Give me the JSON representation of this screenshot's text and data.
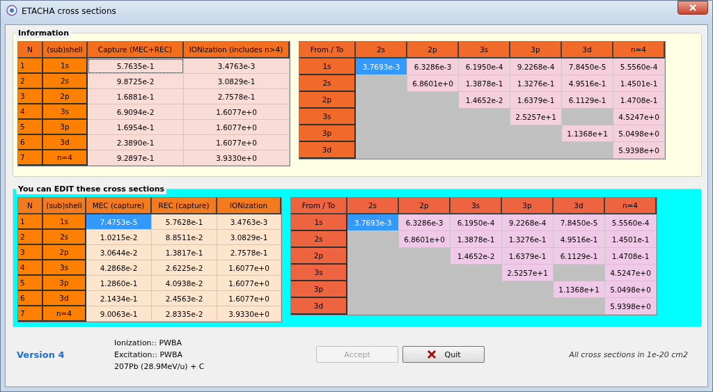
{
  "window": {
    "title": "ETACHA cross sections"
  },
  "information": {
    "title": "Information",
    "table": {
      "row_header_columns": [
        "N",
        "(sub)shell"
      ],
      "columns": [
        "Capture (MEC+REC)",
        "IONization (includes n>4)"
      ],
      "rows": [
        {
          "n": "1",
          "shell": "1s",
          "cells": [
            {
              "text": "5.7635e-1",
              "focused": true
            },
            {
              "text": "3.4763e-3",
              "focused": false
            }
          ]
        },
        {
          "n": "2",
          "shell": "2s",
          "cells": [
            {
              "text": "9.8725e-2",
              "focused": false
            },
            {
              "text": "3.0829e-1",
              "focused": false
            }
          ]
        },
        {
          "n": "3",
          "shell": "2p",
          "cells": [
            {
              "text": "1.6881e-1",
              "focused": false
            },
            {
              "text": "2.7578e-1",
              "focused": false
            }
          ]
        },
        {
          "n": "4",
          "shell": "3s",
          "cells": [
            {
              "text": "6.9094e-2",
              "focused": false
            },
            {
              "text": "1.6077e+0",
              "focused": false
            }
          ]
        },
        {
          "n": "5",
          "shell": "3p",
          "cells": [
            {
              "text": "1.6954e-1",
              "focused": false
            },
            {
              "text": "1.6077e+0",
              "focused": false
            }
          ]
        },
        {
          "n": "6",
          "shell": "3d",
          "cells": [
            {
              "text": "2.3890e-1",
              "focused": false
            },
            {
              "text": "1.6077e+0",
              "focused": false
            }
          ]
        },
        {
          "n": "7",
          "shell": "n=4",
          "cells": [
            {
              "text": "9.2897e-1",
              "focused": false
            },
            {
              "text": "3.9330e+0",
              "focused": false
            }
          ]
        }
      ]
    },
    "matrix": {
      "corner": "From / To",
      "columns": [
        "2s",
        "2p",
        "3s",
        "3p",
        "3d",
        "n=4"
      ],
      "rows": [
        {
          "label": "1s",
          "cells": [
            {
              "text": "3.7693e-3",
              "selected": true
            },
            {
              "text": "6.3286e-3",
              "selected": false
            },
            {
              "text": "6.1950e-4",
              "selected": false
            },
            {
              "text": "9.2268e-4",
              "selected": false
            },
            {
              "text": "7.8450e-5",
              "selected": false
            },
            {
              "text": "5.5560e-4",
              "selected": false
            }
          ]
        },
        {
          "label": "2s",
          "cells": [
            null,
            {
              "text": "6.8601e+0",
              "selected": false
            },
            {
              "text": "1.3878e-1",
              "selected": false
            },
            {
              "text": "1.3276e-1",
              "selected": false
            },
            {
              "text": "4.9516e-1",
              "selected": false
            },
            {
              "text": "1.4501e-1",
              "selected": false
            }
          ]
        },
        {
          "label": "2p",
          "cells": [
            null,
            null,
            {
              "text": "1.4652e-2",
              "selected": false
            },
            {
              "text": "1.6379e-1",
              "selected": false
            },
            {
              "text": "6.1129e-1",
              "selected": false
            },
            {
              "text": "1.4708e-1",
              "selected": false
            }
          ]
        },
        {
          "label": "3s",
          "cells": [
            null,
            null,
            null,
            {
              "text": "2.5257e+1",
              "selected": false
            },
            null,
            {
              "text": "4.5247e+0",
              "selected": false
            }
          ]
        },
        {
          "label": "3p",
          "cells": [
            null,
            null,
            null,
            null,
            {
              "text": "1.1368e+1",
              "selected": false
            },
            {
              "text": "5.0498e+0",
              "selected": false
            }
          ]
        },
        {
          "label": "3d",
          "cells": [
            null,
            null,
            null,
            null,
            null,
            {
              "text": "5.9398e+0",
              "selected": false
            }
          ]
        }
      ]
    }
  },
  "editable": {
    "title": "You can EDIT these cross sections",
    "table": {
      "row_header_columns": [
        "N",
        "(sub)shell"
      ],
      "columns": [
        "MEC (capture)",
        "REC (capture)",
        "IONization"
      ],
      "rows": [
        {
          "n": "1",
          "shell": "1s",
          "cells": [
            {
              "text": "7.4753e-5",
              "selected": true
            },
            {
              "text": "5.7628e-1",
              "selected": false
            },
            {
              "text": "3.4763e-3",
              "selected": false
            }
          ]
        },
        {
          "n": "2",
          "shell": "2s",
          "cells": [
            {
              "text": "1.0215e-2",
              "selected": false
            },
            {
              "text": "8.8511e-2",
              "selected": false
            },
            {
              "text": "3.0829e-1",
              "selected": false
            }
          ]
        },
        {
          "n": "3",
          "shell": "2p",
          "cells": [
            {
              "text": "3.0644e-2",
              "selected": false
            },
            {
              "text": "1.3817e-1",
              "selected": false
            },
            {
              "text": "2.7578e-1",
              "selected": false
            }
          ]
        },
        {
          "n": "4",
          "shell": "3s",
          "cells": [
            {
              "text": "4.2868e-2",
              "selected": false
            },
            {
              "text": "2.6225e-2",
              "selected": false
            },
            {
              "text": "1.6077e+0",
              "selected": false
            }
          ]
        },
        {
          "n": "5",
          "shell": "3p",
          "cells": [
            {
              "text": "1.2860e-1",
              "selected": false
            },
            {
              "text": "4.0938e-2",
              "selected": false
            },
            {
              "text": "1.6077e+0",
              "selected": false
            }
          ]
        },
        {
          "n": "6",
          "shell": "3d",
          "cells": [
            {
              "text": "2.1434e-1",
              "selected": false
            },
            {
              "text": "2.4563e-2",
              "selected": false
            },
            {
              "text": "1.6077e+0",
              "selected": false
            }
          ]
        },
        {
          "n": "7",
          "shell": "n=4",
          "cells": [
            {
              "text": "9.0063e-1",
              "selected": false
            },
            {
              "text": "2.8335e-2",
              "selected": false
            },
            {
              "text": "3.9330e+0",
              "selected": false
            }
          ]
        }
      ]
    },
    "matrix": {
      "corner": "From / To",
      "columns": [
        "2s",
        "2p",
        "3s",
        "3p",
        "3d",
        "n=4"
      ],
      "rows": [
        {
          "label": "1s",
          "cells": [
            {
              "text": "3.7693e-3",
              "selected": true
            },
            {
              "text": "6.3286e-3",
              "selected": false
            },
            {
              "text": "6.1950e-4",
              "selected": false
            },
            {
              "text": "9.2268e-4",
              "selected": false
            },
            {
              "text": "7.8450e-5",
              "selected": false
            },
            {
              "text": "5.5560e-4",
              "selected": false
            }
          ]
        },
        {
          "label": "2s",
          "cells": [
            null,
            {
              "text": "6.8601e+0",
              "selected": false
            },
            {
              "text": "1.3878e-1",
              "selected": false
            },
            {
              "text": "1.3276e-1",
              "selected": false
            },
            {
              "text": "4.9516e-1",
              "selected": false
            },
            {
              "text": "1.4501e-1",
              "selected": false
            }
          ]
        },
        {
          "label": "2p",
          "cells": [
            null,
            null,
            {
              "text": "1.4652e-2",
              "selected": false
            },
            {
              "text": "1.6379e-1",
              "selected": false
            },
            {
              "text": "6.1129e-1",
              "selected": false
            },
            {
              "text": "1.4708e-1",
              "selected": false
            }
          ]
        },
        {
          "label": "3s",
          "cells": [
            null,
            null,
            null,
            {
              "text": "2.5257e+1",
              "selected": false
            },
            null,
            {
              "text": "4.5247e+0",
              "selected": false
            }
          ]
        },
        {
          "label": "3p",
          "cells": [
            null,
            null,
            null,
            null,
            {
              "text": "1.1368e+1",
              "selected": false
            },
            {
              "text": "5.0498e+0",
              "selected": false
            }
          ]
        },
        {
          "label": "3d",
          "cells": [
            null,
            null,
            null,
            null,
            null,
            {
              "text": "5.9398e+0",
              "selected": false
            }
          ]
        }
      ]
    }
  },
  "footer": {
    "version": "Version 4",
    "info_lines": [
      "Ionization:: PWBA",
      "Excitation:: PWBA",
      "207Pb (28.9MeV/u) + C"
    ],
    "buttons": [
      {
        "kind": "accept",
        "label": "Accept",
        "disabled": true
      },
      {
        "kind": "quit",
        "label": "Quit",
        "disabled": false
      }
    ],
    "units_note": "All cross sections in 1e-20 cm2"
  }
}
